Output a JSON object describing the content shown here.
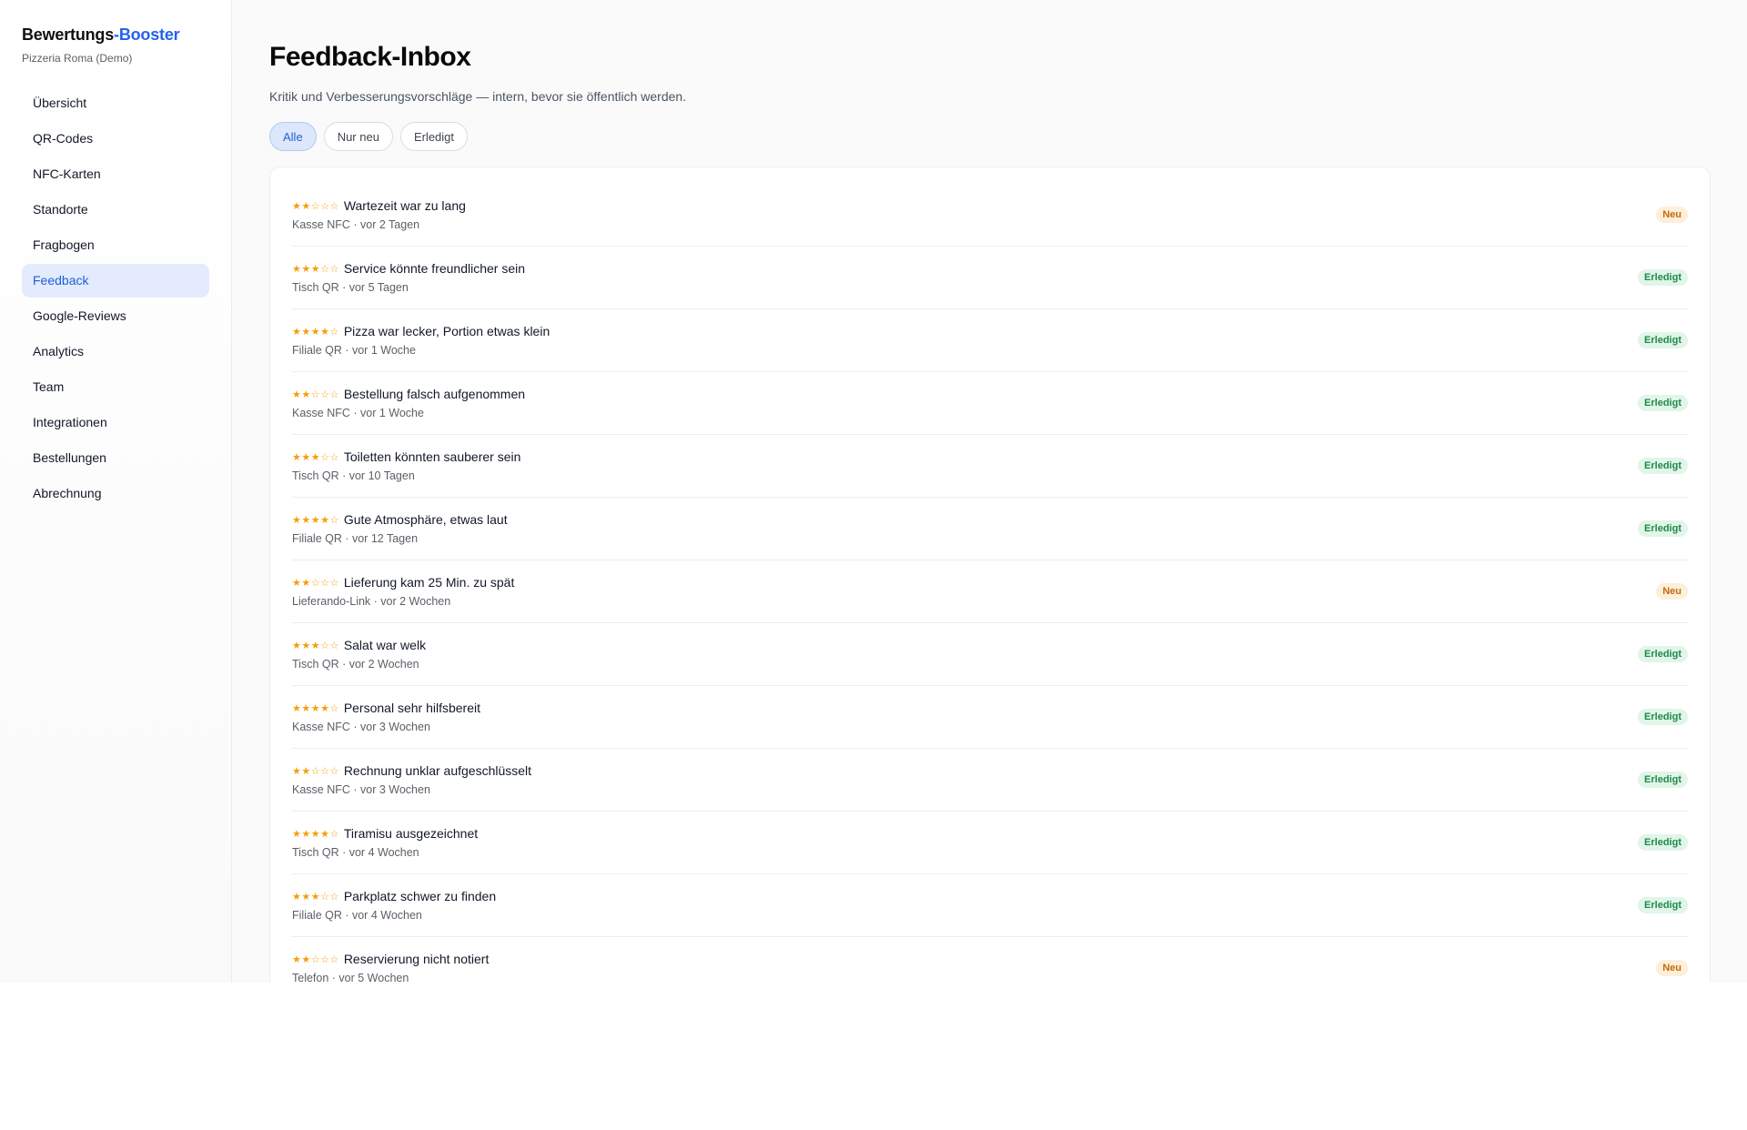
{
  "sidebar": {
    "brand_primary": "Bewertungs",
    "brand_accent": "-Booster",
    "subtitle": "Pizzeria Roma (Demo)",
    "items": [
      {
        "label": "Übersicht",
        "active": false
      },
      {
        "label": "QR-Codes",
        "active": false
      },
      {
        "label": "NFC-Karten",
        "active": false
      },
      {
        "label": "Standorte",
        "active": false
      },
      {
        "label": "Fragbogen",
        "active": false
      },
      {
        "label": "Feedback",
        "active": true
      },
      {
        "label": "Google-Reviews",
        "active": false
      },
      {
        "label": "Analytics",
        "active": false
      },
      {
        "label": "Team",
        "active": false
      },
      {
        "label": "Integrationen",
        "active": false
      },
      {
        "label": "Bestellungen",
        "active": false
      },
      {
        "label": "Abrechnung",
        "active": false
      }
    ]
  },
  "main": {
    "title": "Feedback-Inbox",
    "description": "Kritik und Verbesserungsvorschläge — intern, bevor sie öffentlich werden.",
    "filters": [
      {
        "label": "Alle",
        "active": true
      },
      {
        "label": "Nur neu",
        "active": false
      },
      {
        "label": "Erledigt",
        "active": false
      }
    ]
  },
  "feedback": [
    {
      "rating": 2,
      "stars": "★★☆☆☆",
      "title": "Wartezeit war zu lang",
      "meta": "Kasse NFC · vor 2 Tagen",
      "status": "Neu"
    },
    {
      "rating": 3,
      "stars": "★★★☆☆",
      "title": "Service könnte freundlicher sein",
      "meta": "Tisch QR · vor 5 Tagen",
      "status": "Erledigt"
    },
    {
      "rating": 4,
      "stars": "★★★★☆",
      "title": "Pizza war lecker, Portion etwas klein",
      "meta": "Filiale QR · vor 1 Woche",
      "status": "Erledigt"
    },
    {
      "rating": 2,
      "stars": "★★☆☆☆",
      "title": "Bestellung falsch aufgenommen",
      "meta": "Kasse NFC · vor 1 Woche",
      "status": "Erledigt"
    },
    {
      "rating": 3,
      "stars": "★★★☆☆",
      "title": "Toiletten könnten sauberer sein",
      "meta": "Tisch QR · vor 10 Tagen",
      "status": "Erledigt"
    },
    {
      "rating": 4,
      "stars": "★★★★☆",
      "title": "Gute Atmosphäre, etwas laut",
      "meta": "Filiale QR · vor 12 Tagen",
      "status": "Erledigt"
    },
    {
      "rating": 2,
      "stars": "★★☆☆☆",
      "title": "Lieferung kam 25 Min. zu spät",
      "meta": "Lieferando-Link · vor 2 Wochen",
      "status": "Neu"
    },
    {
      "rating": 3,
      "stars": "★★★☆☆",
      "title": "Salat war welk",
      "meta": "Tisch QR · vor 2 Wochen",
      "status": "Erledigt"
    },
    {
      "rating": 4,
      "stars": "★★★★☆",
      "title": "Personal sehr hilfsbereit",
      "meta": "Kasse NFC · vor 3 Wochen",
      "status": "Erledigt"
    },
    {
      "rating": 2,
      "stars": "★★☆☆☆",
      "title": "Rechnung unklar aufgeschlüsselt",
      "meta": "Kasse NFC · vor 3 Wochen",
      "status": "Erledigt"
    },
    {
      "rating": 4,
      "stars": "★★★★☆",
      "title": "Tiramisu ausgezeichnet",
      "meta": "Tisch QR · vor 4 Wochen",
      "status": "Erledigt"
    },
    {
      "rating": 3,
      "stars": "★★★☆☆",
      "title": "Parkplatz schwer zu finden",
      "meta": "Filiale QR · vor 4 Wochen",
      "status": "Erledigt"
    },
    {
      "rating": 2,
      "stars": "★★☆☆☆",
      "title": "Reservierung nicht notiert",
      "meta": "Telefon · vor 5 Wochen",
      "status": "Neu"
    }
  ],
  "colors": {
    "accent": "#2563eb",
    "star": "#f59e0b",
    "badge_new_bg": "#fdf0db",
    "badge_new_text": "#c46a0a",
    "badge_done_bg": "#e1f5e8",
    "badge_done_text": "#1f8a4c"
  }
}
